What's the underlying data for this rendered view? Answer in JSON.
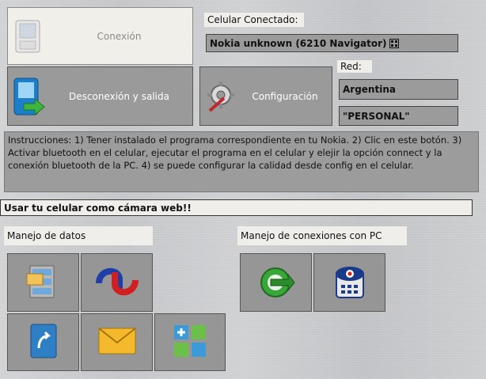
{
  "buttons": {
    "connect": "Conexión",
    "disconnect": "Desconexión y salida",
    "config": "Configuración"
  },
  "phone": {
    "label": "Celular Conectado:",
    "value": "Nokia unknown (6210 Navigator)"
  },
  "network": {
    "label": "Red:",
    "country": "Argentina",
    "operator": "\"PERSONAL\""
  },
  "instructions": "Instrucciones: 1) Tener instalado el programa correspondiente en tu Nokia. 2) Clic en este botón. 3) Activar bluetooth en el celular, ejecutar el programa en el celular y elejir la opción connect y la conexión bluetooth de la PC. 4) se puede configurar la calidad desde config en el celular.",
  "webcam_label": "Usar tu celular como cámara web!!",
  "sections": {
    "data": "Manejo de datos",
    "connections": "Manejo de conexiones con PC"
  },
  "icons": {
    "connect": "phone-icon",
    "disconnect": "phone-exit-icon",
    "config": "gear-wrench-icon",
    "data": [
      "file-manager-icon",
      "sync-icon",
      "contacts-icon",
      "messages-icon",
      "apps-icon"
    ],
    "connections": [
      "connection-manager-icon",
      "webcam-icon"
    ]
  }
}
